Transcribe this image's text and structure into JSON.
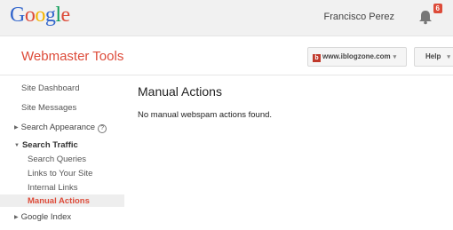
{
  "header": {
    "logo_letters": [
      {
        "ch": "G",
        "color": "#3366cc"
      },
      {
        "ch": "o",
        "color": "#dd4b39"
      },
      {
        "ch": "o",
        "color": "#f4b400"
      },
      {
        "ch": "g",
        "color": "#3366cc"
      },
      {
        "ch": "l",
        "color": "#0f9d58"
      },
      {
        "ch": "e",
        "color": "#dd4b39"
      }
    ],
    "user_name": "Francisco Perez",
    "notification_count": "6",
    "bell_icon": "bell-icon"
  },
  "product_bar": {
    "product_name": "Webmaster Tools",
    "site_selector": "www.iblogzone.com",
    "site_caret": "▾",
    "help_label": "Help",
    "help_caret": "▾"
  },
  "sidebar": {
    "site_dashboard": "Site Dashboard",
    "site_messages": "Site Messages",
    "search_appearance": "Search Appearance",
    "search_appearance_help": "?",
    "search_traffic": "Search Traffic",
    "search_queries": "Search Queries",
    "links_to_site": "Links to Your Site",
    "internal_links": "Internal Links",
    "manual_actions": "Manual Actions",
    "google_index": "Google Index",
    "collapsed_marker": "▶",
    "expanded_marker": "▼"
  },
  "main": {
    "title": "Manual Actions",
    "message": "No manual webspam actions found."
  },
  "colors": {
    "accent": "#dd4b39",
    "topbar_bg": "#f1f1f1"
  }
}
